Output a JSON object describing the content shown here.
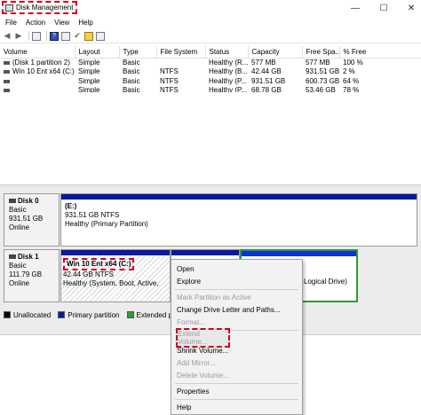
{
  "window": {
    "title": "Disk Management",
    "min_icon": "minimize-icon",
    "max_icon": "maximize-icon",
    "close_icon": "close-icon"
  },
  "menu": [
    "File",
    "Action",
    "View",
    "Help"
  ],
  "toolbar": [
    "back-arrow-icon",
    "forward-arrow-icon",
    "disk-list-icon",
    "help-icon",
    "properties-icon",
    "check-icon",
    "folder-icon",
    "refresh-icon"
  ],
  "table": {
    "columns": [
      "Volume",
      "Layout",
      "Type",
      "File System",
      "Status",
      "Capacity",
      "Free Spa...",
      "% Free"
    ],
    "rows": [
      [
        "(Disk 1 partition 2)",
        "Simple",
        "Basic",
        "",
        "Healthy (R...",
        "577 MB",
        "577 MB",
        "100 %"
      ],
      [
        "Win 10 Ent x64 (C:)",
        "Simple",
        "Basic",
        "NTFS",
        "Healthy (B...",
        "42.44 GB",
        "931.51 GB",
        "2 %"
      ],
      [
        "",
        "Simple",
        "Basic",
        "NTFS",
        "Healthy (P...",
        "931.51 GB",
        "600.73 GB",
        "64 %"
      ],
      [
        "",
        "Simple",
        "Basic",
        "NTFS",
        "Healthy (P...",
        "68.78 GB",
        "53.46 GB",
        "78 %"
      ]
    ]
  },
  "disk0": {
    "name": "Disk 0",
    "type": "Basic",
    "size": "931.51 GB",
    "status": "Online",
    "partition": {
      "label": "(E:)",
      "size": "931.51 GB NTFS",
      "status": "Healthy (Primary Partition)"
    }
  },
  "disk1": {
    "name": "Disk 1",
    "type": "Basic",
    "size": "111.79 GB",
    "status": "Online",
    "c_partition": {
      "label": "Win 10 Ent x64 (C:)",
      "size": "42.44 GB NTFS",
      "status": "Healthy (System, Boot, Active,"
    },
    "logical_fragment": "Logical Drive)"
  },
  "legend": [
    {
      "label": "Unallocated",
      "color": "#000000"
    },
    {
      "label": "Primary partition",
      "color": "#0a1a9c"
    },
    {
      "label": "Extended p",
      "color": "#2f9a2f"
    }
  ],
  "context_menu": {
    "open": "Open",
    "explore": "Explore",
    "mark_active": "Mark Partition as Active",
    "change_letter": "Change Drive Letter and Paths...",
    "format": "Format...",
    "extend": "Extend Volume...",
    "shrink": "Shrink Volume...",
    "add_mirror": "Add Mirror...",
    "delete": "Delete Volume...",
    "properties": "Properties",
    "help": "Help"
  },
  "colors": {
    "primary_partition": "#0a1a9c",
    "extended_partition": "#2f9a2f",
    "annotation": "#d0001b"
  }
}
